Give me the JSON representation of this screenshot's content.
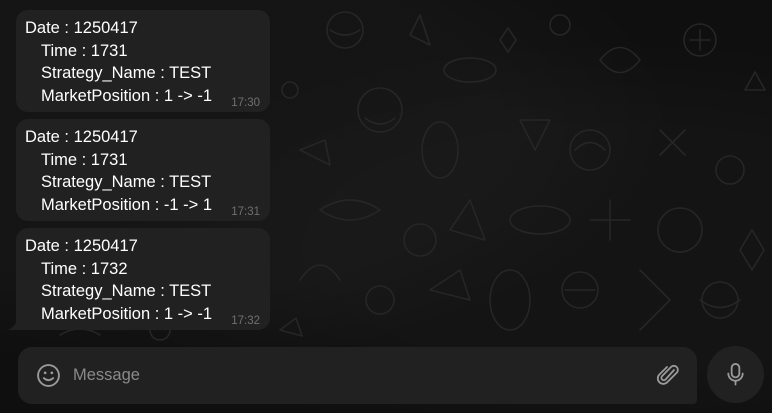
{
  "messages": [
    {
      "date_line": "Date : 1250417",
      "time_line": "Time : 1731",
      "strategy_line": "Strategy_Name : TEST",
      "position_line": "MarketPosition : 1 -> -1",
      "timestamp": "17:30"
    },
    {
      "date_line": "Date : 1250417",
      "time_line": "Time : 1731",
      "strategy_line": "Strategy_Name : TEST",
      "position_line": "MarketPosition : -1 -> 1",
      "timestamp": "17:31"
    },
    {
      "date_line": "Date : 1250417",
      "time_line": "Time : 1732",
      "strategy_line": "Strategy_Name : TEST",
      "position_line": "MarketPosition : 1 -> -1",
      "timestamp": "17:32"
    }
  ],
  "composer": {
    "placeholder": "Message",
    "emoji_icon": "smiley-icon",
    "attach_icon": "paperclip-icon",
    "mic_icon": "microphone-icon"
  },
  "colors": {
    "background": "#0f0f0f",
    "bubble": "#212121",
    "text": "#ffffff",
    "timestamp": "#707070",
    "placeholder": "#8a8a8a",
    "icon": "#9a9a9a"
  }
}
